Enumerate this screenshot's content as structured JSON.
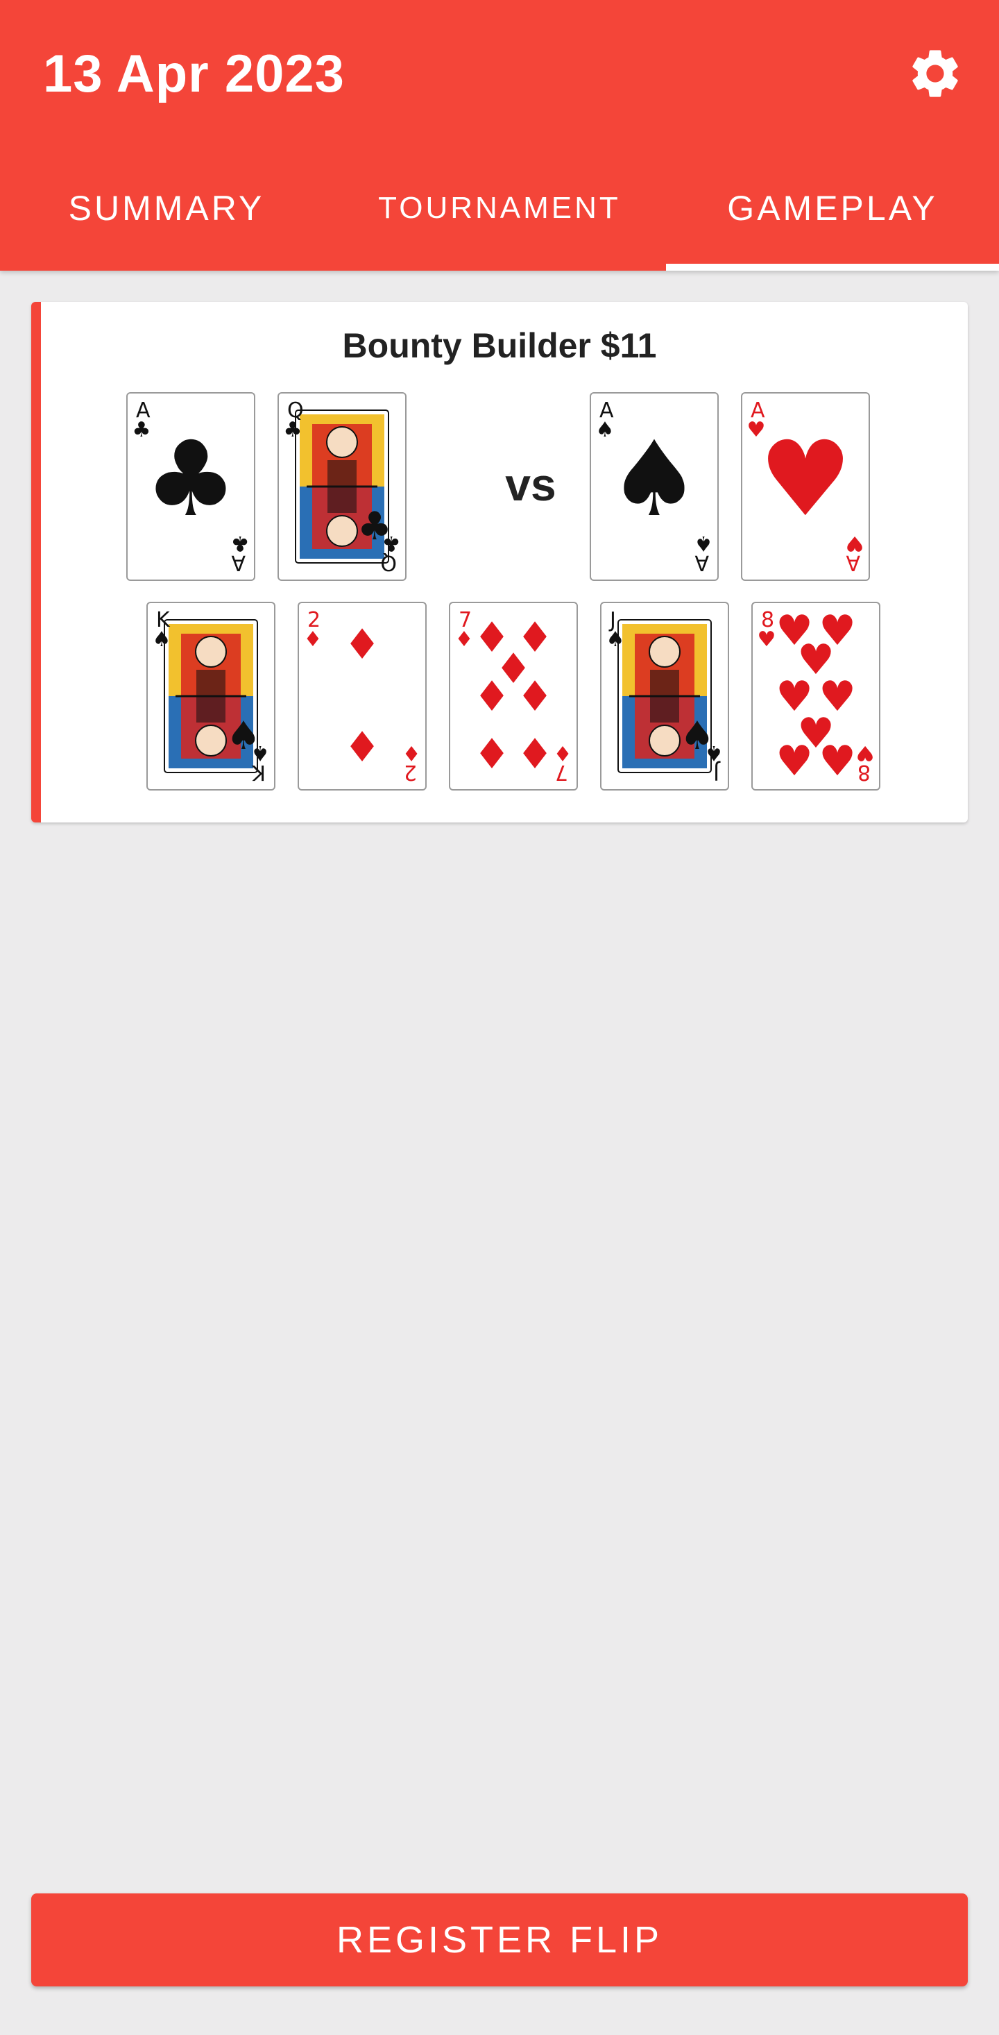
{
  "header": {
    "date": "13 Apr 2023",
    "settings_icon": "gear-icon",
    "accent_color": "#f44539"
  },
  "tabs": [
    {
      "label": "SUMMARY",
      "active": false
    },
    {
      "label": "TOURNAMENT",
      "active": false
    },
    {
      "label": "GAMEPLAY",
      "active": true
    }
  ],
  "flip": {
    "tournament": "Bounty Builder $11",
    "vs_label": "vs",
    "hero_hand": [
      {
        "rank": "A",
        "suit": "clubs"
      },
      {
        "rank": "Q",
        "suit": "clubs"
      }
    ],
    "villain_hand": [
      {
        "rank": "A",
        "suit": "spades"
      },
      {
        "rank": "A",
        "suit": "hearts"
      }
    ],
    "board": [
      {
        "rank": "K",
        "suit": "spades"
      },
      {
        "rank": "2",
        "suit": "diamonds"
      },
      {
        "rank": "7",
        "suit": "diamonds"
      },
      {
        "rank": "J",
        "suit": "spades"
      },
      {
        "rank": "8",
        "suit": "hearts"
      }
    ]
  },
  "actions": {
    "register_label": "REGISTER FLIP"
  }
}
